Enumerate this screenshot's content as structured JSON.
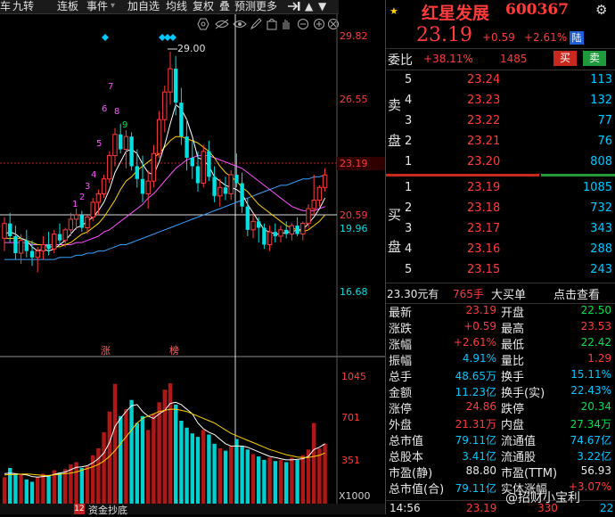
{
  "toolbar": {
    "items": [
      "车",
      "九转",
      "连板",
      "事件",
      "加自选",
      "均线",
      "复权",
      "叠",
      "预测",
      "更多"
    ]
  },
  "chart": {
    "price_labels": [
      "29.82",
      "26.55",
      "23.19",
      "20.59",
      "19.96",
      "16.68"
    ],
    "high_label": "29.00",
    "volume_labels": [
      "1045",
      "701",
      "351",
      "X1000"
    ],
    "markers": [
      "涨",
      "榜"
    ],
    "td_counts": [
      "1",
      "2",
      "3",
      "4",
      "5",
      "6",
      "7",
      "8",
      "9"
    ],
    "bottom_tab_num": "12",
    "bottom_tab_label": "资金抄底"
  },
  "chart_data": {
    "type": "candlestick",
    "y_range": [
      15.8,
      30.6
    ],
    "candles": [
      {
        "o": 20.2,
        "h": 21.2,
        "l": 19.6,
        "c": 20.9
      },
      {
        "o": 20.9,
        "h": 21.4,
        "l": 20.0,
        "c": 20.3
      },
      {
        "o": 20.3,
        "h": 20.8,
        "l": 19.2,
        "c": 19.5
      },
      {
        "o": 19.5,
        "h": 20.4,
        "l": 19.0,
        "c": 20.1
      },
      {
        "o": 20.1,
        "h": 20.6,
        "l": 19.3,
        "c": 19.6
      },
      {
        "o": 19.6,
        "h": 20.1,
        "l": 18.9,
        "c": 19.3
      },
      {
        "o": 19.3,
        "h": 19.8,
        "l": 18.6,
        "c": 19.6
      },
      {
        "o": 19.6,
        "h": 20.3,
        "l": 19.2,
        "c": 19.9
      },
      {
        "o": 19.9,
        "h": 20.5,
        "l": 19.4,
        "c": 19.7
      },
      {
        "o": 19.7,
        "h": 20.6,
        "l": 19.5,
        "c": 20.4
      },
      {
        "o": 20.4,
        "h": 20.9,
        "l": 19.9,
        "c": 20.1
      },
      {
        "o": 20.1,
        "h": 20.7,
        "l": 19.8,
        "c": 20.6
      },
      {
        "o": 20.6,
        "h": 21.4,
        "l": 20.3,
        "c": 21.1
      },
      {
        "o": 21.1,
        "h": 21.6,
        "l": 20.6,
        "c": 21.3
      },
      {
        "o": 21.3,
        "h": 21.5,
        "l": 20.5,
        "c": 20.7
      },
      {
        "o": 20.7,
        "h": 21.3,
        "l": 20.4,
        "c": 21.2
      },
      {
        "o": 21.2,
        "h": 22.1,
        "l": 21.0,
        "c": 21.9
      },
      {
        "o": 21.9,
        "h": 22.5,
        "l": 21.3,
        "c": 22.3
      },
      {
        "o": 22.3,
        "h": 23.2,
        "l": 22.1,
        "c": 23.0
      },
      {
        "o": 23.0,
        "h": 24.3,
        "l": 22.8,
        "c": 24.1
      },
      {
        "o": 24.1,
        "h": 25.4,
        "l": 23.6,
        "c": 25.1
      },
      {
        "o": 25.1,
        "h": 25.6,
        "l": 24.2,
        "c": 24.4
      },
      {
        "o": 24.4,
        "h": 25.3,
        "l": 23.5,
        "c": 25.0
      },
      {
        "o": 25.0,
        "h": 25.2,
        "l": 23.4,
        "c": 23.6
      },
      {
        "o": 23.6,
        "h": 24.4,
        "l": 22.6,
        "c": 23.0
      },
      {
        "o": 23.0,
        "h": 24.1,
        "l": 21.9,
        "c": 22.3
      },
      {
        "o": 22.3,
        "h": 23.4,
        "l": 21.6,
        "c": 22.9
      },
      {
        "o": 22.9,
        "h": 24.6,
        "l": 22.6,
        "c": 24.2
      },
      {
        "o": 24.2,
        "h": 26.2,
        "l": 24.0,
        "c": 25.8
      },
      {
        "o": 25.8,
        "h": 27.4,
        "l": 25.2,
        "c": 27.1
      },
      {
        "o": 27.1,
        "h": 29.0,
        "l": 26.5,
        "c": 28.2
      },
      {
        "o": 28.2,
        "h": 28.8,
        "l": 26.0,
        "c": 26.6
      },
      {
        "o": 26.6,
        "h": 27.3,
        "l": 24.6,
        "c": 25.0
      },
      {
        "o": 25.0,
        "h": 25.8,
        "l": 23.4,
        "c": 24.0
      },
      {
        "o": 24.0,
        "h": 24.8,
        "l": 23.0,
        "c": 23.6
      },
      {
        "o": 23.6,
        "h": 24.3,
        "l": 22.4,
        "c": 22.8
      },
      {
        "o": 22.8,
        "h": 24.6,
        "l": 22.6,
        "c": 24.3
      },
      {
        "o": 24.3,
        "h": 24.8,
        "l": 22.9,
        "c": 23.1
      },
      {
        "o": 23.1,
        "h": 23.6,
        "l": 21.9,
        "c": 22.2
      },
      {
        "o": 22.2,
        "h": 23.0,
        "l": 21.7,
        "c": 22.6
      },
      {
        "o": 22.6,
        "h": 23.1,
        "l": 22.0,
        "c": 22.3
      },
      {
        "o": 22.3,
        "h": 23.4,
        "l": 22.0,
        "c": 23.2
      },
      {
        "o": 23.2,
        "h": 24.2,
        "l": 22.6,
        "c": 22.8
      },
      {
        "o": 22.8,
        "h": 23.3,
        "l": 21.4,
        "c": 21.7
      },
      {
        "o": 21.7,
        "h": 22.1,
        "l": 20.3,
        "c": 20.6
      },
      {
        "o": 20.6,
        "h": 21.4,
        "l": 20.2,
        "c": 21.0
      },
      {
        "o": 21.0,
        "h": 21.2,
        "l": 20.0,
        "c": 20.7
      },
      {
        "o": 20.7,
        "h": 20.9,
        "l": 19.7,
        "c": 19.9
      },
      {
        "o": 19.9,
        "h": 20.8,
        "l": 19.6,
        "c": 20.5
      },
      {
        "o": 20.5,
        "h": 20.9,
        "l": 20.0,
        "c": 20.3
      },
      {
        "o": 20.3,
        "h": 20.8,
        "l": 20.0,
        "c": 20.6
      },
      {
        "o": 20.6,
        "h": 21.0,
        "l": 20.2,
        "c": 20.4
      },
      {
        "o": 20.4,
        "h": 20.9,
        "l": 20.1,
        "c": 20.8
      },
      {
        "o": 20.8,
        "h": 21.2,
        "l": 20.3,
        "c": 20.4
      },
      {
        "o": 20.4,
        "h": 21.0,
        "l": 20.1,
        "c": 20.9
      },
      {
        "o": 20.9,
        "h": 21.8,
        "l": 20.7,
        "c": 21.6
      },
      {
        "o": 21.6,
        "h": 23.2,
        "l": 21.3,
        "c": 22.0
      },
      {
        "o": 22.0,
        "h": 22.7,
        "l": 21.7,
        "c": 22.6
      },
      {
        "o": 22.6,
        "h": 23.5,
        "l": 22.4,
        "c": 23.19
      }
    ],
    "volume_range": [
      0,
      1200
    ],
    "volumes": [
      230,
      310,
      260,
      250,
      210,
      190,
      230,
      260,
      240,
      290,
      270,
      300,
      340,
      360,
      310,
      330,
      420,
      480,
      620,
      800,
      1040,
      760,
      820,
      900,
      700,
      760,
      640,
      780,
      880,
      990,
      1045,
      860,
      720,
      660,
      610,
      580,
      640,
      600,
      520,
      480,
      460,
      500,
      560,
      500,
      470,
      430,
      410,
      380,
      400,
      370,
      380,
      360,
      400,
      380,
      420,
      470,
      700,
      480,
      520
    ],
    "ma5": [
      20.4,
      20.5,
      20.4,
      20.2,
      20.1,
      19.8,
      19.6,
      19.7,
      19.6,
      19.7,
      19.9,
      20.1,
      20.4,
      20.7,
      20.8,
      21.0,
      21.2,
      21.5,
      21.9,
      22.5,
      23.3,
      23.8,
      24.3,
      24.4,
      24.2,
      23.7,
      23.3,
      23.2,
      23.8,
      24.6,
      25.6,
      26.5,
      26.3,
      25.8,
      25.0,
      24.0,
      23.9,
      23.6,
      23.1,
      22.9,
      22.7,
      22.6,
      22.5,
      22.3,
      21.8,
      21.4,
      21.0,
      20.6,
      20.5,
      20.4,
      20.4,
      20.5,
      20.5,
      20.6,
      20.6,
      20.9,
      21.2,
      21.6,
      22.1
    ],
    "ma10": [
      20.2,
      20.2,
      20.2,
      20.2,
      20.1,
      20.0,
      19.9,
      19.9,
      19.8,
      19.8,
      19.8,
      19.9,
      20.0,
      20.2,
      20.4,
      20.5,
      20.7,
      20.9,
      21.2,
      21.6,
      22.0,
      22.5,
      22.9,
      23.1,
      23.4,
      23.6,
      23.8,
      24.0,
      24.2,
      24.5,
      24.8,
      25.0,
      25.0,
      24.9,
      24.8,
      24.7,
      24.5,
      24.3,
      24.0,
      23.6,
      23.3,
      23.1,
      22.9,
      22.6,
      22.4,
      22.1,
      21.8,
      21.6,
      21.4,
      21.2,
      21.0,
      20.8,
      20.7,
      20.6,
      20.5,
      20.6,
      20.8,
      21.0,
      21.3
    ],
    "ma20": [
      20.0,
      20.0,
      20.0,
      20.0,
      20.0,
      19.9,
      19.9,
      19.9,
      19.9,
      19.9,
      19.9,
      19.9,
      19.9,
      20.0,
      20.0,
      20.1,
      20.2,
      20.3,
      20.5,
      20.6,
      20.8,
      21.0,
      21.2,
      21.4,
      21.6,
      21.8,
      22.1,
      22.3,
      22.6,
      22.9,
      23.2,
      23.5,
      23.7,
      23.9,
      24.0,
      24.1,
      24.1,
      24.1,
      24.0,
      23.9,
      23.8,
      23.7,
      23.6,
      23.5,
      23.3,
      23.1,
      22.9,
      22.7,
      22.5,
      22.3,
      22.1,
      21.9,
      21.7,
      21.6,
      21.5,
      21.5,
      21.5,
      21.6,
      21.7
    ],
    "ma60": [
      19.2,
      19.2,
      19.2,
      19.2,
      19.2,
      19.2,
      19.2,
      19.2,
      19.2,
      19.2,
      19.3,
      19.3,
      19.3,
      19.4,
      19.4,
      19.5,
      19.5,
      19.6,
      19.6,
      19.7,
      19.8,
      19.9,
      19.9,
      20.0,
      20.1,
      20.2,
      20.3,
      20.4,
      20.5,
      20.6,
      20.7,
      20.8,
      20.9,
      21.0,
      21.1,
      21.2,
      21.3,
      21.4,
      21.5,
      21.6,
      21.7,
      21.8,
      21.9,
      22.0,
      22.1,
      22.2,
      22.3,
      22.4,
      22.5,
      22.6,
      22.7,
      22.7,
      22.8,
      22.9,
      23.0,
      23.0,
      23.1,
      23.1,
      23.2
    ],
    "vol_ma5": [
      260,
      265,
      260,
      255,
      250,
      235,
      230,
      235,
      240,
      255,
      265,
      275,
      295,
      315,
      320,
      330,
      355,
      390,
      440,
      530,
      670,
      740,
      800,
      850,
      860,
      800,
      760,
      740,
      780,
      810,
      870,
      880,
      860,
      820,
      780,
      700,
      650,
      620,
      600,
      560,
      520,
      500,
      500,
      500,
      490,
      470,
      450,
      430,
      410,
      400,
      390,
      380,
      380,
      385,
      390,
      410,
      470,
      490,
      520
    ],
    "vol_ma10": [
      250,
      252,
      254,
      256,
      258,
      255,
      250,
      245,
      245,
      250,
      255,
      260,
      265,
      275,
      290,
      305,
      320,
      340,
      370,
      410,
      460,
      520,
      580,
      640,
      700,
      740,
      760,
      780,
      800,
      810,
      820,
      820,
      810,
      800,
      780,
      760,
      740,
      720,
      700,
      670,
      640,
      610,
      590,
      570,
      550,
      530,
      510,
      490,
      470,
      455,
      440,
      425,
      415,
      405,
      400,
      400,
      410,
      420,
      440
    ]
  },
  "quote": {
    "title": "红星发展",
    "code": "600367",
    "price": "23.19",
    "change": "+0.59",
    "change_pct": "+2.61%",
    "market_tag": "陆",
    "weibi_label": "委比",
    "weibi_val": "+38.11%",
    "weicha_val": "1485",
    "buy_btn": "买",
    "sell_btn": "卖",
    "sell_side": {
      "label_top": "卖",
      "label_bottom": "盘",
      "rows": [
        {
          "level": "5",
          "price": "23.24",
          "vol": "113"
        },
        {
          "level": "4",
          "price": "23.23",
          "vol": "132"
        },
        {
          "level": "3",
          "price": "23.22",
          "vol": "77"
        },
        {
          "level": "2",
          "price": "23.21",
          "vol": "76"
        },
        {
          "level": "1",
          "price": "23.20",
          "vol": "808"
        }
      ]
    },
    "buy_side": {
      "label_top": "买",
      "label_bottom": "盘",
      "rows": [
        {
          "level": "1",
          "price": "23.19",
          "vol": "1085"
        },
        {
          "level": "2",
          "price": "23.18",
          "vol": "732"
        },
        {
          "level": "3",
          "price": "23.17",
          "vol": "343"
        },
        {
          "level": "4",
          "price": "23.16",
          "vol": "288"
        },
        {
          "level": "5",
          "price": "23.15",
          "vol": "243"
        }
      ]
    },
    "big_order": {
      "price": "23.30元有",
      "qty": "765手",
      "label": "大买单",
      "link": "点击查看"
    },
    "stats": [
      {
        "l1": "最新",
        "v1": "23.19",
        "c1": "red",
        "l2": "开盘",
        "v2": "22.50",
        "c2": "green"
      },
      {
        "l1": "涨跌",
        "v1": "+0.59",
        "c1": "red",
        "l2": "最高",
        "v2": "23.53",
        "c2": "red"
      },
      {
        "l1": "涨幅",
        "v1": "+2.61%",
        "c1": "red",
        "l2": "最低",
        "v2": "22.42",
        "c2": "green"
      },
      {
        "l1": "振幅",
        "v1": "4.91%",
        "c1": "cyan",
        "l2": "量比",
        "v2": "1.29",
        "c2": "red"
      },
      {
        "l1": "总手",
        "v1": "48.65万",
        "c1": "cyan",
        "l2": "换手",
        "v2": "15.11%",
        "c2": "cyan"
      },
      {
        "l1": "金额",
        "v1": "11.23亿",
        "c1": "cyan",
        "l2": "换手(实)",
        "v2": "22.43%",
        "c2": "cyan"
      },
      {
        "l1": "涨停",
        "v1": "24.86",
        "c1": "red",
        "l2": "跌停",
        "v2": "20.34",
        "c2": "green"
      },
      {
        "l1": "外盘",
        "v1": "21.31万",
        "c1": "red",
        "l2": "内盘",
        "v2": "27.34万",
        "c2": "green"
      },
      {
        "l1": "总市值",
        "v1": "79.11亿",
        "c1": "cyan",
        "l2": "流通值",
        "v2": "74.67亿",
        "c2": "cyan"
      },
      {
        "l1": "总股本",
        "v1": "3.41亿",
        "c1": "cyan",
        "l2": "流通股",
        "v2": "3.22亿",
        "c2": "cyan"
      },
      {
        "l1": "市盈(静)",
        "v1": "88.80",
        "c1": "white",
        "l2": "市盈(TTM)",
        "v2": "56.93",
        "c2": "white"
      },
      {
        "l1": "总市值(合)",
        "v1": "79.11亿",
        "c1": "cyan",
        "l2": "实体涨幅",
        "v2": "+3.07%",
        "c2": "red"
      }
    ],
    "tick": {
      "time": "14:56",
      "price": "23.19",
      "vol": "330",
      "extra": "22"
    },
    "watermark": "@招财小宝利"
  },
  "colors": {
    "up": "#ff3b3b",
    "down": "#00e0e0",
    "ma5": "#ffffff",
    "ma10": "#ffd400",
    "ma20": "#ff50ff",
    "ma60": "#3aa0ff"
  }
}
